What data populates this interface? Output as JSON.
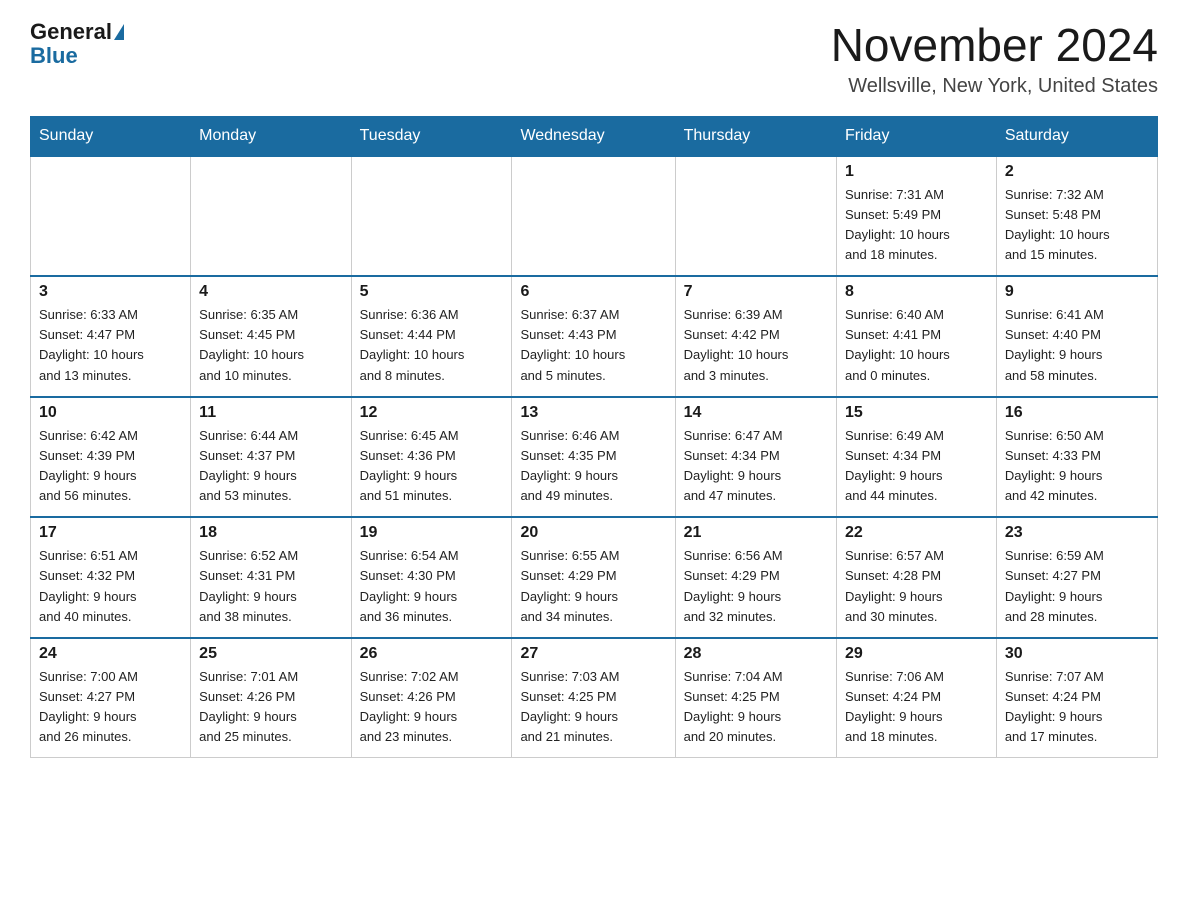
{
  "header": {
    "logo_line1": "General",
    "logo_line2": "Blue",
    "month_title": "November 2024",
    "location": "Wellsville, New York, United States"
  },
  "weekdays": [
    "Sunday",
    "Monday",
    "Tuesday",
    "Wednesday",
    "Thursday",
    "Friday",
    "Saturday"
  ],
  "weeks": [
    [
      {
        "day": "",
        "info": ""
      },
      {
        "day": "",
        "info": ""
      },
      {
        "day": "",
        "info": ""
      },
      {
        "day": "",
        "info": ""
      },
      {
        "day": "",
        "info": ""
      },
      {
        "day": "1",
        "info": "Sunrise: 7:31 AM\nSunset: 5:49 PM\nDaylight: 10 hours\nand 18 minutes."
      },
      {
        "day": "2",
        "info": "Sunrise: 7:32 AM\nSunset: 5:48 PM\nDaylight: 10 hours\nand 15 minutes."
      }
    ],
    [
      {
        "day": "3",
        "info": "Sunrise: 6:33 AM\nSunset: 4:47 PM\nDaylight: 10 hours\nand 13 minutes."
      },
      {
        "day": "4",
        "info": "Sunrise: 6:35 AM\nSunset: 4:45 PM\nDaylight: 10 hours\nand 10 minutes."
      },
      {
        "day": "5",
        "info": "Sunrise: 6:36 AM\nSunset: 4:44 PM\nDaylight: 10 hours\nand 8 minutes."
      },
      {
        "day": "6",
        "info": "Sunrise: 6:37 AM\nSunset: 4:43 PM\nDaylight: 10 hours\nand 5 minutes."
      },
      {
        "day": "7",
        "info": "Sunrise: 6:39 AM\nSunset: 4:42 PM\nDaylight: 10 hours\nand 3 minutes."
      },
      {
        "day": "8",
        "info": "Sunrise: 6:40 AM\nSunset: 4:41 PM\nDaylight: 10 hours\nand 0 minutes."
      },
      {
        "day": "9",
        "info": "Sunrise: 6:41 AM\nSunset: 4:40 PM\nDaylight: 9 hours\nand 58 minutes."
      }
    ],
    [
      {
        "day": "10",
        "info": "Sunrise: 6:42 AM\nSunset: 4:39 PM\nDaylight: 9 hours\nand 56 minutes."
      },
      {
        "day": "11",
        "info": "Sunrise: 6:44 AM\nSunset: 4:37 PM\nDaylight: 9 hours\nand 53 minutes."
      },
      {
        "day": "12",
        "info": "Sunrise: 6:45 AM\nSunset: 4:36 PM\nDaylight: 9 hours\nand 51 minutes."
      },
      {
        "day": "13",
        "info": "Sunrise: 6:46 AM\nSunset: 4:35 PM\nDaylight: 9 hours\nand 49 minutes."
      },
      {
        "day": "14",
        "info": "Sunrise: 6:47 AM\nSunset: 4:34 PM\nDaylight: 9 hours\nand 47 minutes."
      },
      {
        "day": "15",
        "info": "Sunrise: 6:49 AM\nSunset: 4:34 PM\nDaylight: 9 hours\nand 44 minutes."
      },
      {
        "day": "16",
        "info": "Sunrise: 6:50 AM\nSunset: 4:33 PM\nDaylight: 9 hours\nand 42 minutes."
      }
    ],
    [
      {
        "day": "17",
        "info": "Sunrise: 6:51 AM\nSunset: 4:32 PM\nDaylight: 9 hours\nand 40 minutes."
      },
      {
        "day": "18",
        "info": "Sunrise: 6:52 AM\nSunset: 4:31 PM\nDaylight: 9 hours\nand 38 minutes."
      },
      {
        "day": "19",
        "info": "Sunrise: 6:54 AM\nSunset: 4:30 PM\nDaylight: 9 hours\nand 36 minutes."
      },
      {
        "day": "20",
        "info": "Sunrise: 6:55 AM\nSunset: 4:29 PM\nDaylight: 9 hours\nand 34 minutes."
      },
      {
        "day": "21",
        "info": "Sunrise: 6:56 AM\nSunset: 4:29 PM\nDaylight: 9 hours\nand 32 minutes."
      },
      {
        "day": "22",
        "info": "Sunrise: 6:57 AM\nSunset: 4:28 PM\nDaylight: 9 hours\nand 30 minutes."
      },
      {
        "day": "23",
        "info": "Sunrise: 6:59 AM\nSunset: 4:27 PM\nDaylight: 9 hours\nand 28 minutes."
      }
    ],
    [
      {
        "day": "24",
        "info": "Sunrise: 7:00 AM\nSunset: 4:27 PM\nDaylight: 9 hours\nand 26 minutes."
      },
      {
        "day": "25",
        "info": "Sunrise: 7:01 AM\nSunset: 4:26 PM\nDaylight: 9 hours\nand 25 minutes."
      },
      {
        "day": "26",
        "info": "Sunrise: 7:02 AM\nSunset: 4:26 PM\nDaylight: 9 hours\nand 23 minutes."
      },
      {
        "day": "27",
        "info": "Sunrise: 7:03 AM\nSunset: 4:25 PM\nDaylight: 9 hours\nand 21 minutes."
      },
      {
        "day": "28",
        "info": "Sunrise: 7:04 AM\nSunset: 4:25 PM\nDaylight: 9 hours\nand 20 minutes."
      },
      {
        "day": "29",
        "info": "Sunrise: 7:06 AM\nSunset: 4:24 PM\nDaylight: 9 hours\nand 18 minutes."
      },
      {
        "day": "30",
        "info": "Sunrise: 7:07 AM\nSunset: 4:24 PM\nDaylight: 9 hours\nand 17 minutes."
      }
    ]
  ]
}
